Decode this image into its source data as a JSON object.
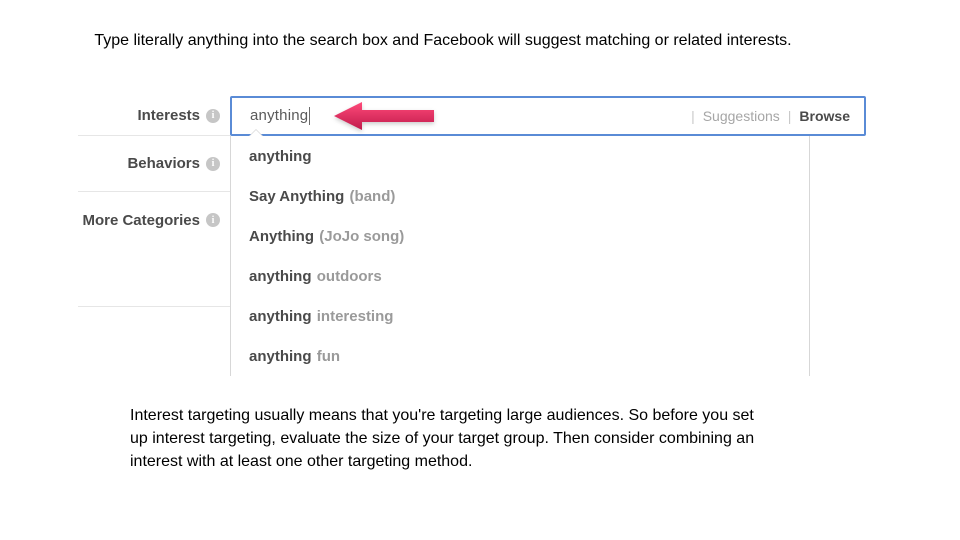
{
  "caption_top": "Type literally anything into the search box and Facebook will suggest matching or related interests.",
  "sidebar": {
    "interests": "Interests",
    "behaviors": "Behaviors",
    "more_categories": "More Categories"
  },
  "search": {
    "typed": "anything",
    "suggestions_label": "Suggestions",
    "browse_label": "Browse"
  },
  "dropdown": [
    {
      "text": "anything"
    },
    {
      "text": "Say Anything",
      "suffix": "(band)"
    },
    {
      "text": "Anything",
      "suffix": "(JoJo song)"
    },
    {
      "text": "anything",
      "suffix": "outdoors"
    },
    {
      "text": "anything",
      "suffix": "interesting"
    },
    {
      "text": "anything",
      "suffix": "fun"
    }
  ],
  "caption_bottom": "Interest targeting usually means that you're targeting large audiences. So before you set up interest targeting, evaluate the size of your target group. Then consider combining an interest with at least one other targeting method."
}
